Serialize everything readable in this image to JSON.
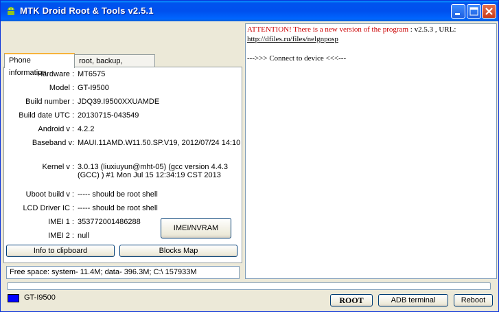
{
  "window": {
    "title": "MTK Droid Root & Tools v2.5.1"
  },
  "tabs": [
    {
      "label": "Phone information"
    },
    {
      "label": "root, backup, recovery"
    }
  ],
  "phone_info": {
    "hardware_label": "Hardware :",
    "hardware_value": "MT6575",
    "model_label": "Model :",
    "model_value": "GT-I9500",
    "build_number_label": "Build number :",
    "build_number_value": "JDQ39.I9500XXUAMDE",
    "build_date_label": "Build date UTC :",
    "build_date_value": "20130715-043549",
    "android_label": "Android  v :",
    "android_value": "4.2.2",
    "baseband_label": "Baseband v:",
    "baseband_value": "MAUI.11AMD.W11.50.SP.V19, 2012/07/24 14:10",
    "kernel_label": "Kernel v :",
    "kernel_value_line1": "3.0.13 (liuxiuyun@mht-05) (gcc version 4.4.3",
    "kernel_value_line2": "(GCC) ) #1  Mon Jul 15 12:34:19 CST 2013",
    "uboot_label": "Uboot build v :",
    "uboot_value": "----- should be  root shell",
    "lcd_label": "LCD Driver IC :",
    "lcd_value": "----- should be  root shell",
    "imei1_label": "IMEI 1 :",
    "imei1_value": "353772001486288",
    "imei2_label": "IMEI 2 :",
    "imei2_value": "null"
  },
  "buttons": {
    "imei_nvram": "IMEI/NVRAM",
    "info_clipboard": "Info to clipboard",
    "blocks_map": "Blocks Map",
    "root": "ROOT",
    "adb_terminal": "ADB terminal",
    "reboot": "Reboot"
  },
  "free_space": "Free space: system- 11.4M; data- 396.3M;  C:\\ 157933M",
  "log": {
    "attention_prefix": "ATTENTION!  There is a new version of the program",
    "attention_suffix": " : v2.5.3 , URL:",
    "url": "http://dfiles.ru/files/nelgnposp",
    "connect_line": "--->>> Connect to device <<<---"
  },
  "status": {
    "device_name": "GT-I9500",
    "device_color": "#0000ff"
  },
  "progress_value": 0,
  "colors": {
    "attention": "#cc0000",
    "titlebar": "#0053ee"
  }
}
